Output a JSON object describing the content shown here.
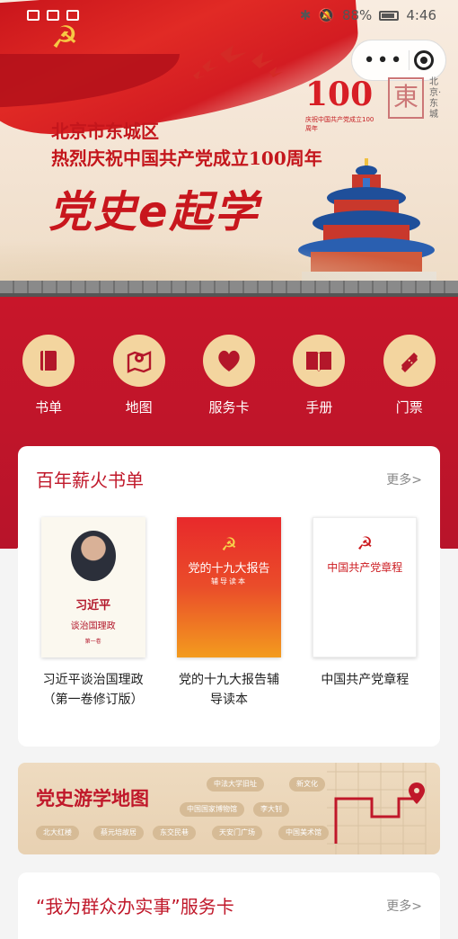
{
  "status": {
    "battery": "88%",
    "time": "4:46"
  },
  "banner": {
    "line1": "北京市东城区",
    "line2": "热烈庆祝中国共产党成立100周年",
    "slogan": "党史e起学",
    "logo_number": "100",
    "logo_sub": "庆祝中国共产党成立100周年",
    "seal_char": "東",
    "seal_side": "北京·东城"
  },
  "nav": [
    {
      "label": "书单",
      "icon": "book-icon"
    },
    {
      "label": "地图",
      "icon": "map-pin-icon"
    },
    {
      "label": "服务卡",
      "icon": "heart-icon"
    },
    {
      "label": "手册",
      "icon": "open-book-icon"
    },
    {
      "label": "门票",
      "icon": "ticket-icon"
    }
  ],
  "books_section": {
    "title": "百年薪火书单",
    "more": "更多>",
    "books": [
      {
        "title": "习近平谈治国理政（第一卷修订版）",
        "cover_line1": "习近平",
        "cover_line2": "谈治国理政",
        "cover_line3": "第一卷"
      },
      {
        "title": "党的十九大报告辅导读本",
        "cover_line1": "党的十九大报告",
        "cover_line2": "辅导读本"
      },
      {
        "title": "中国共产党章程",
        "cover_line1": "中国共产党章程"
      }
    ]
  },
  "map_section": {
    "title": "党史游学地图",
    "tags": [
      "中法大学旧址",
      "新文化",
      "中国国家博物馆",
      "李大钊",
      "北大红楼",
      "蔡元培故居",
      "东交民巷",
      "天安门广场",
      "中国美术馆"
    ]
  },
  "service_section": {
    "title": "“我为群众办实事”服务卡",
    "more": "更多>"
  },
  "colors": {
    "brand_red": "#c0182a",
    "gold": "#f3d59f"
  }
}
